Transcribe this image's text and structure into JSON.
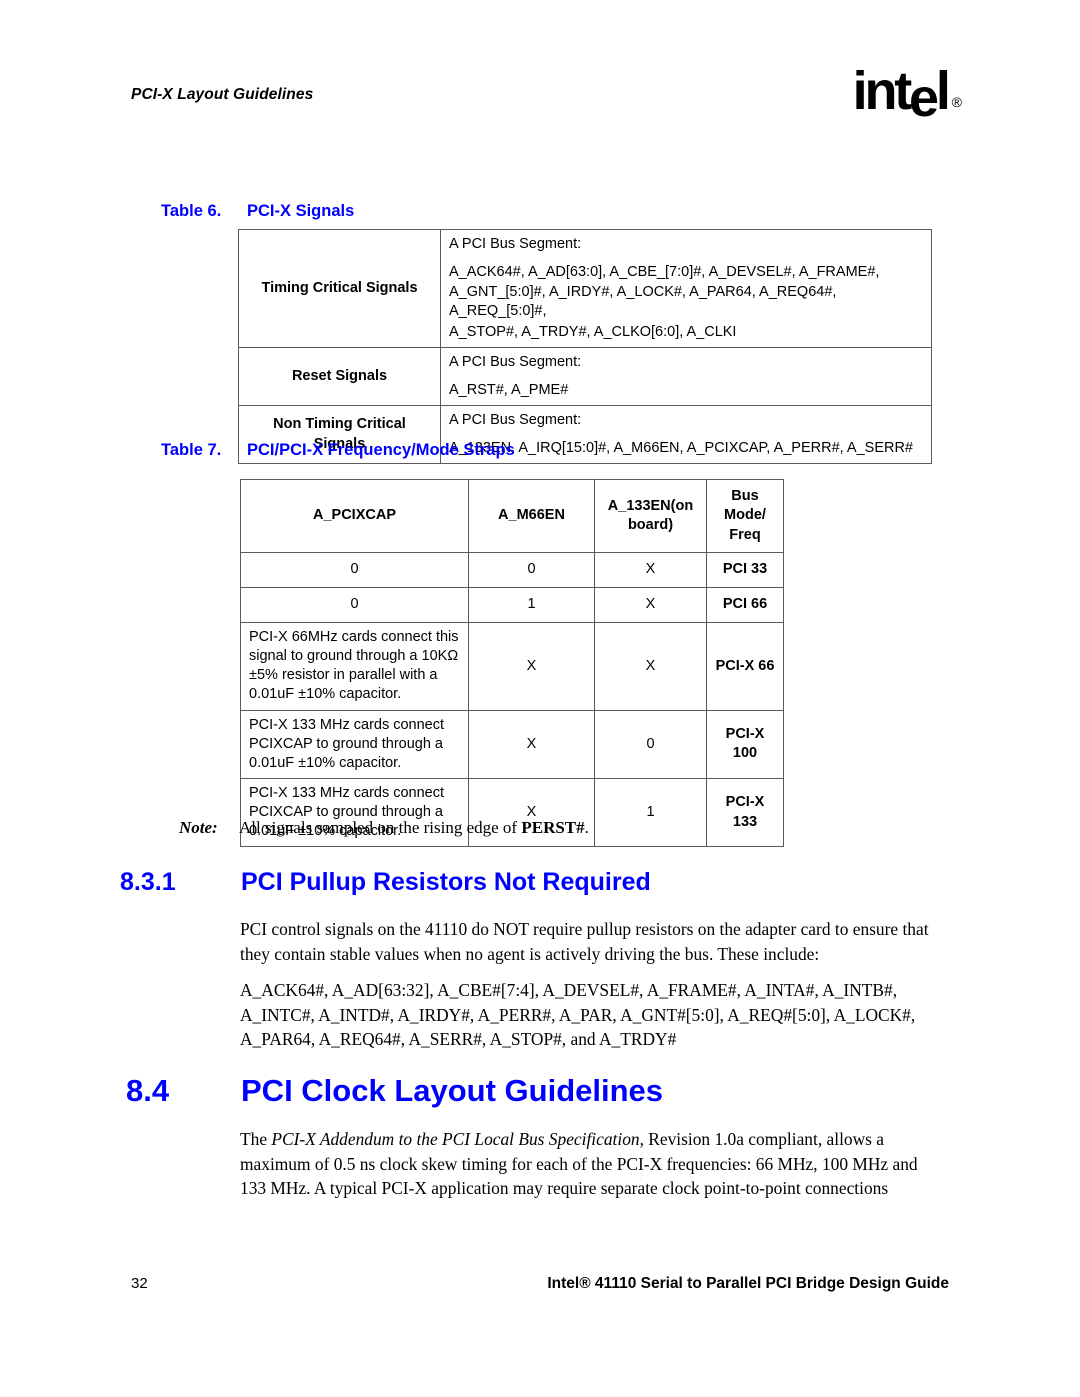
{
  "header": {
    "running_head": "PCI-X Layout Guidelines",
    "logo_text_1": "int",
    "logo_text_2": "e",
    "logo_text_3": "l",
    "logo_reg": "®"
  },
  "table6": {
    "caption_num": "Table 6.",
    "caption_text": "PCI-X Signals",
    "rows": [
      {
        "label": "Timing Critical Signals",
        "line1": "A PCI Bus Segment:",
        "line2": "A_ACK64#, A_AD[63:0], A_CBE_[7:0]#, A_DEVSEL#, A_FRAME#,",
        "line3": "A_GNT_[5:0]#, A_IRDY#, A_LOCK#, A_PAR64, A_REQ64#, A_REQ_[5:0]#,",
        "line4": "A_STOP#, A_TRDY#, A_CLKO[6:0], A_CLKI"
      },
      {
        "label": "Reset Signals",
        "line1": "A PCI Bus Segment:",
        "line2": "A_RST#, A_PME#"
      },
      {
        "label_line1": "Non Timing Critical",
        "label_line2": "Signals",
        "line1": "A PCI Bus Segment:",
        "line2": "A_133EN, A_IRQ[15:0]#, A_M66EN, A_PCIXCAP, A_PERR#, A_SERR#"
      }
    ]
  },
  "table7": {
    "caption_num": "Table 7.",
    "caption_text": "PCI/PCI-X Frequency/Mode Straps",
    "headers": {
      "col1": "A_PCIXCAP",
      "col2": "A_M66EN",
      "col3_line1": "A_133EN(on",
      "col3_line2": "board)",
      "col4_line1": "Bus",
      "col4_line2": "Mode/",
      "col4_line3": "Freq"
    },
    "rows": [
      {
        "pcixcap": "0",
        "m66en": "0",
        "en133": "X",
        "mode": "PCI 33"
      },
      {
        "pcixcap": "0",
        "m66en": "1",
        "en133": "X",
        "mode": "PCI 66"
      },
      {
        "pcixcap_l1": "PCI-X 66MHz cards connect this",
        "pcixcap_l2": "signal to ground through a 10KΩ",
        "pcixcap_l3": "±5% resistor in parallel with a",
        "pcixcap_l4": "0.01uF ±10% capacitor.",
        "m66en": "X",
        "en133": "X",
        "mode": "PCI-X 66"
      },
      {
        "pcixcap_l1": "PCI-X 133 MHz cards connect",
        "pcixcap_l2": "PCIXCAP to ground through a",
        "pcixcap_l3": "0.01uF ±10% capacitor.",
        "m66en": "X",
        "en133": "0",
        "mode": "PCI-X 100"
      },
      {
        "pcixcap_l1": "PCI-X 133 MHz cards connect",
        "pcixcap_l2": "PCIXCAP to ground through a",
        "pcixcap_l3": "0.01uF ±10% capacitor.",
        "m66en": "X",
        "en133": "1",
        "mode": "PCI-X 133"
      }
    ]
  },
  "note": {
    "label": "Note:",
    "text_before": "All signals sampled on the rising edge of ",
    "bold_term": "PERST#",
    "text_after": "."
  },
  "section_831": {
    "number": "8.3.1",
    "title": "PCI Pullup Resistors Not Required",
    "para1": "PCI control signals on the 41110 do NOT require pullup resistors on the adapter card to ensure that they contain stable values when no agent is actively driving the bus. These include:",
    "para2": "A_ACK64#, A_AD[63:32], A_CBE#[7:4], A_DEVSEL#, A_FRAME#, A_INTA#, A_INTB#, A_INTC#, A_INTD#, A_IRDY#, A_PERR#, A_PAR, A_GNT#[5:0], A_REQ#[5:0], A_LOCK#, A_PAR64, A_REQ64#, A_SERR#, A_STOP#, and A_TRDY#"
  },
  "section_84": {
    "number": "8.4",
    "title": "PCI Clock Layout Guidelines",
    "para_before": "The ",
    "para_italic": "PCI-X Addendum to the PCI Local Bus Specification",
    "para_after": ", Revision 1.0a compliant, allows a maximum of 0.5 ns clock skew timing for each of the PCI-X frequencies: 66 MHz, 100 MHz and 133 MHz. A typical PCI-X application may require separate clock point-to-point connections"
  },
  "footer": {
    "page_number": "32",
    "doc_title": "Intel® 41110 Serial to Parallel PCI Bridge Design Guide"
  },
  "colors": {
    "heading_blue": "#0000FF",
    "rule_gray": "#5A5A5A",
    "text_black": "#000000"
  }
}
